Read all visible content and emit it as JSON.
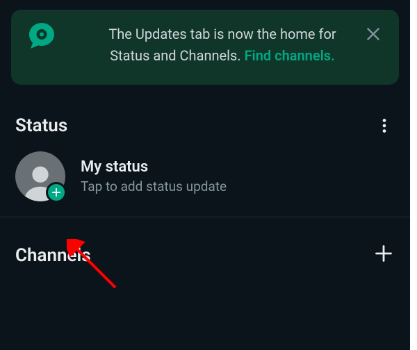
{
  "banner": {
    "icon": "whatsapp-channel-icon",
    "text_line_1": "The Updates tab is now the home for",
    "text_line_2_prefix": "Status and Channels. ",
    "link_label": "Find channels.",
    "close_label": "Close"
  },
  "status": {
    "title": "Status",
    "menu_label": "More options",
    "my_status": {
      "title": "My status",
      "subtitle": "Tap to add status update",
      "add_label": "Add status"
    }
  },
  "channels": {
    "title": "Channels",
    "add_label": "Find channels"
  },
  "colors": {
    "accent": "#00a884",
    "bg": "#0b141a",
    "banner_bg": "#103629",
    "muted": "#8696a0"
  }
}
